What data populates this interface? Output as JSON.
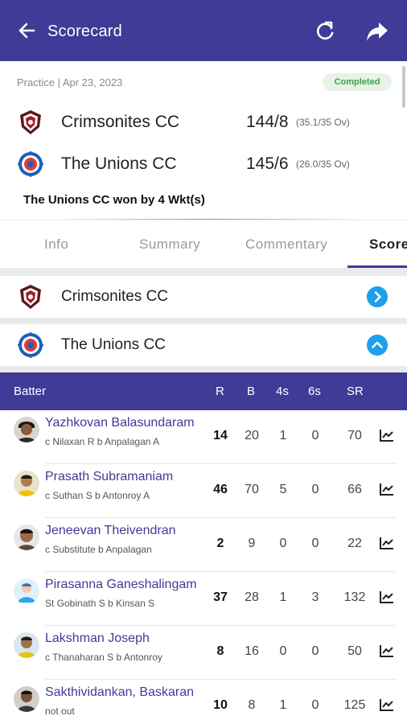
{
  "appbar": {
    "title": "Scorecard",
    "back_icon": "back-arrow-icon",
    "refresh_icon": "refresh-icon",
    "share_icon": "share-icon",
    "bg_color": "#3f3b96"
  },
  "match": {
    "meta": "Practice | Apr 23, 2023",
    "status": "Completed",
    "teams": [
      {
        "name": "Crimsonites CC",
        "score": "144/8",
        "overs": "(35.1/35 Ov)"
      },
      {
        "name": "The Unions CC",
        "score": "145/6",
        "overs": "(26.0/35 Ov)"
      }
    ],
    "result": "The Unions CC won by 4 Wkt(s)"
  },
  "tabs": [
    {
      "label": "Info"
    },
    {
      "label": "Summary"
    },
    {
      "label": "Commentary"
    },
    {
      "label": "Score"
    }
  ],
  "innings_sections": [
    {
      "name": "Crimsonites CC",
      "state": "collapsed"
    },
    {
      "name": "The Unions CC",
      "state": "expanded"
    }
  ],
  "table": {
    "headers": {
      "batter": "Batter",
      "r": "R",
      "b": "B",
      "fours": "4s",
      "sixes": "6s",
      "sr": "SR"
    },
    "rows": [
      {
        "name": "Yazhkovan Balasundaram",
        "dismissal": "c Nilaxan R b Anpalagan A",
        "r": "14",
        "b": "20",
        "fours": "1",
        "sixes": "0",
        "sr": "70"
      },
      {
        "name": "Prasath Subramaniam",
        "dismissal": "c Suthan S b Antonroy A",
        "r": "46",
        "b": "70",
        "fours": "5",
        "sixes": "0",
        "sr": "66"
      },
      {
        "name": "Jeneevan Theivendran",
        "dismissal": "c Substitute b Anpalagan",
        "r": "2",
        "b": "9",
        "fours": "0",
        "sixes": "0",
        "sr": "22"
      },
      {
        "name": "Pirasanna Ganeshalingam",
        "dismissal": "St Gobinath S b Kinsan S",
        "r": "37",
        "b": "28",
        "fours": "1",
        "sixes": "3",
        "sr": "132"
      },
      {
        "name": "Lakshman Joseph",
        "dismissal": "c Thanaharan S b Antonroy",
        "r": "8",
        "b": "16",
        "fours": "0",
        "sixes": "0",
        "sr": "50"
      },
      {
        "name": "Sakthividankan, Baskaran",
        "dismissal": "not out",
        "r": "10",
        "b": "8",
        "fours": "1",
        "sixes": "0",
        "sr": "125"
      }
    ]
  }
}
